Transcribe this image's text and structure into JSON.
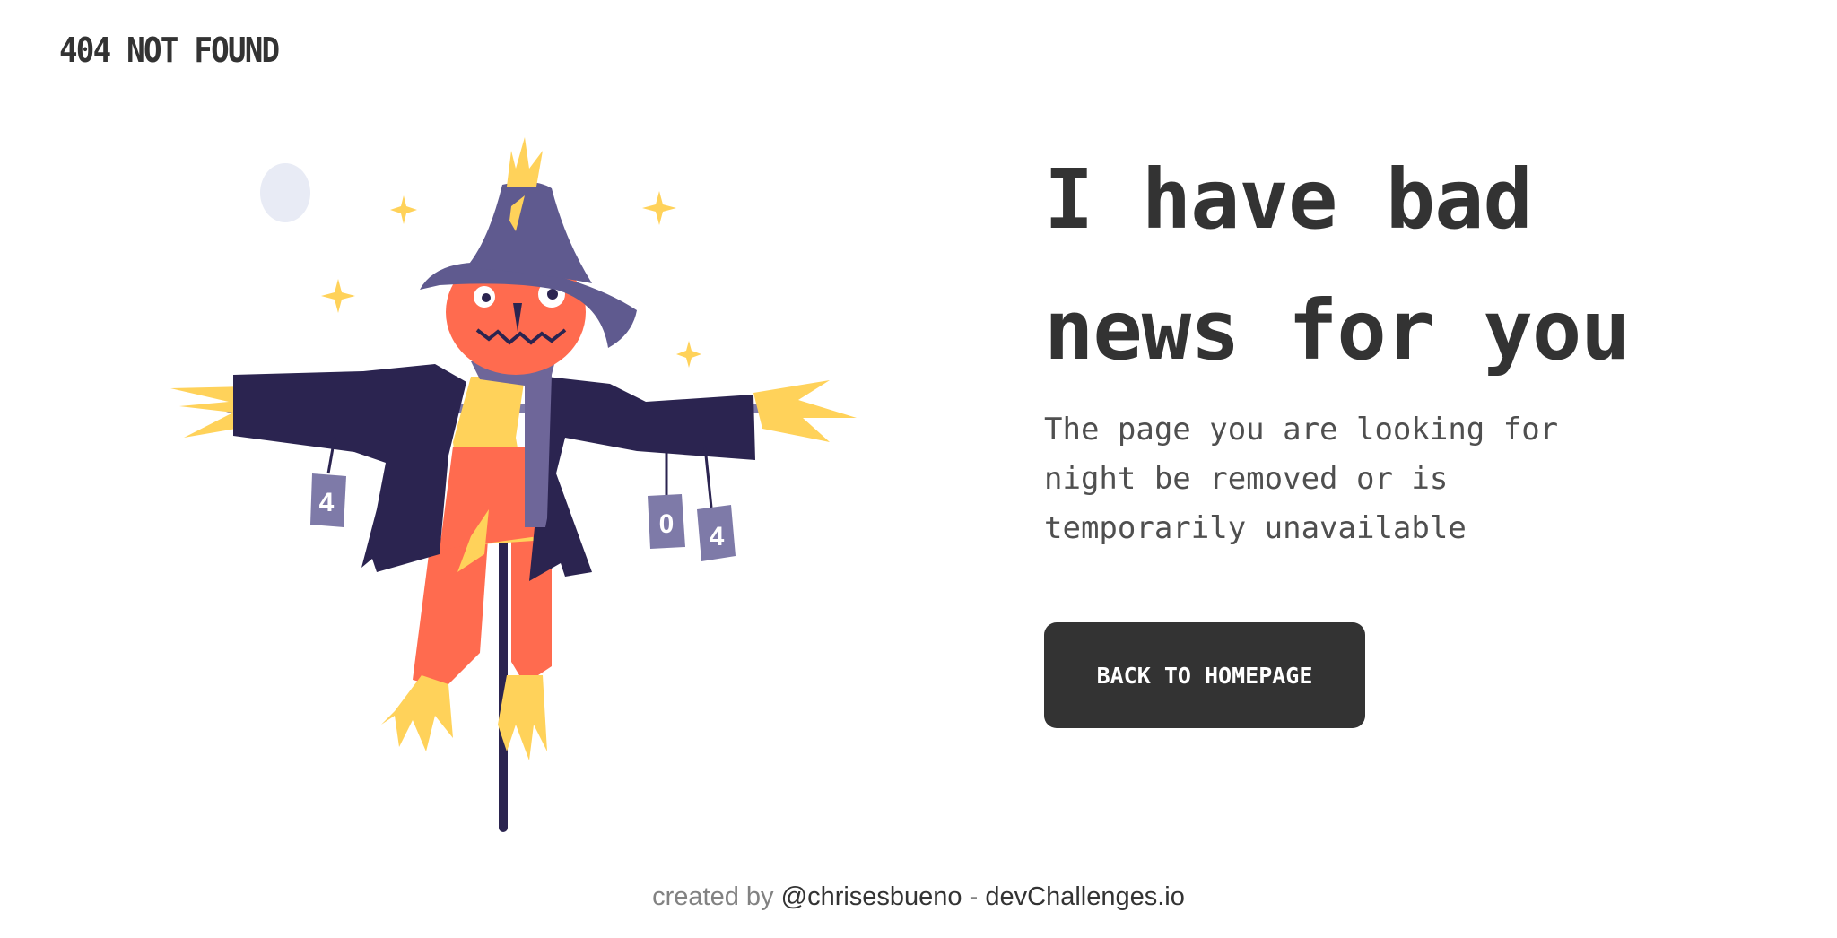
{
  "header": {
    "brand": "404 NOT FOUND"
  },
  "illustration": {
    "label": "scarecrow-illustration",
    "can_labels": [
      "4",
      "0",
      "4"
    ]
  },
  "main": {
    "headline_line1": "I have bad",
    "headline_line2": "news for you",
    "subtext_line1": "The page you are looking for",
    "subtext_line2": "night be removed or is",
    "subtext_line3": "temporarily unavailable",
    "cta_label": "BACK TO HOMEPAGE"
  },
  "footer": {
    "prefix": "created by",
    "author": "@chrisesbueno",
    "separator": "-",
    "site": "devChallenges.io"
  },
  "colors": {
    "text": "#333333",
    "button_bg": "#333333",
    "button_text": "#ffffff",
    "hat": "#5F5A8F",
    "coat": "#2B2450",
    "face": "#FF6B4F",
    "straw": "#FFD25A",
    "scarf": "#6E6699",
    "moon": "#E8EBF5"
  }
}
